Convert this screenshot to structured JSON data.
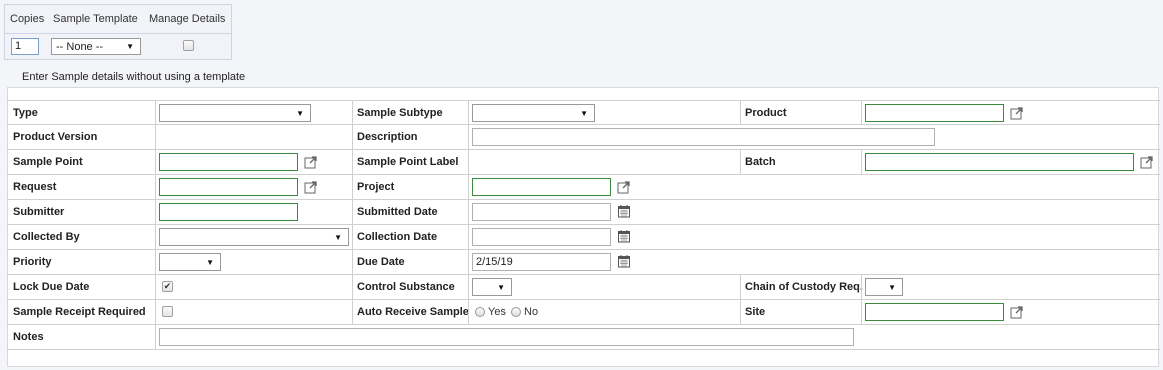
{
  "template_panel": {
    "headers": [
      "Copies",
      "Sample Template",
      "Manage Details"
    ],
    "copies_value": "1",
    "template_selected": "-- None --",
    "manage_details_checked": false
  },
  "intro_text": "Enter Sample details without using a template",
  "fields": {
    "type": {
      "label": "Type",
      "value": ""
    },
    "sample_subtype": {
      "label": "Sample Subtype",
      "value": ""
    },
    "product": {
      "label": "Product",
      "value": ""
    },
    "product_version": {
      "label": "Product Version",
      "value": ""
    },
    "description": {
      "label": "Description",
      "value": ""
    },
    "sample_point": {
      "label": "Sample Point",
      "value": ""
    },
    "sample_point_label": {
      "label": "Sample Point Label",
      "value": ""
    },
    "batch": {
      "label": "Batch",
      "value": ""
    },
    "request": {
      "label": "Request",
      "value": ""
    },
    "project": {
      "label": "Project",
      "value": ""
    },
    "submitter": {
      "label": "Submitter",
      "value": ""
    },
    "submitted_date": {
      "label": "Submitted Date",
      "value": ""
    },
    "collected_by": {
      "label": "Collected By",
      "value": ""
    },
    "collection_date": {
      "label": "Collection Date",
      "value": ""
    },
    "priority": {
      "label": "Priority",
      "value": ""
    },
    "due_date": {
      "label": "Due Date",
      "value": "2/15/19"
    },
    "lock_due_date": {
      "label": "Lock Due Date",
      "checked": true
    },
    "control_substance": {
      "label": "Control Substance",
      "value": ""
    },
    "chain_of_custody": {
      "label": "Chain of Custody Req.",
      "value": ""
    },
    "sample_receipt_required": {
      "label": "Sample Receipt Required",
      "checked": false
    },
    "auto_receive_sample": {
      "label": "Auto Receive Sample",
      "options": [
        "Yes",
        "No"
      ],
      "selected": null
    },
    "site": {
      "label": "Site",
      "value": ""
    },
    "notes": {
      "label": "Notes",
      "value": ""
    }
  },
  "colors": {
    "required_border": "#3c8a3c",
    "grid_line": "#d0d0d0",
    "page_bg": "#f4f5f9"
  },
  "icons": {
    "lookup": "external-link-icon",
    "date": "calendar-icon",
    "dropdown": "dropdown-arrow-icon"
  }
}
